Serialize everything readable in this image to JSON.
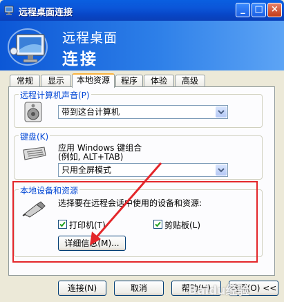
{
  "window": {
    "title": "远程桌面连接",
    "minimize_label": "_",
    "maximize_label": "□",
    "close_label": "×"
  },
  "banner": {
    "line1": "远程桌面",
    "line2": "连接"
  },
  "tabs": [
    {
      "label": "常规"
    },
    {
      "label": "显示"
    },
    {
      "label": "本地资源"
    },
    {
      "label": "程序"
    },
    {
      "label": "体验"
    },
    {
      "label": "高级"
    }
  ],
  "active_tab": "本地资源",
  "sound": {
    "group_label": "远程计算机声音(P)",
    "selected": "带到这台计算机"
  },
  "keyboard": {
    "group_label": "键盘(K)",
    "desc_line1": "应用 Windows 键组合",
    "desc_line2": "(例如, ALT+TAB)",
    "selected": "只用全屏模式"
  },
  "devices": {
    "group_label": "本地设备和资源",
    "desc": "选择要在远程会话中使用的设备和资源:",
    "printer_label": "打印机(T)",
    "printer_checked": true,
    "clipboard_label": "剪贴板(L)",
    "clipboard_checked": true,
    "details_button": "详细信息(M)..."
  },
  "footer": {
    "connect": "连接(N)",
    "cancel": "取消",
    "help": "帮助(H)",
    "options": "选项(O) <<"
  },
  "watermark": "Baidu经验",
  "colors": {
    "accent": "#0a5fe0",
    "highlight": "#e3262a"
  }
}
